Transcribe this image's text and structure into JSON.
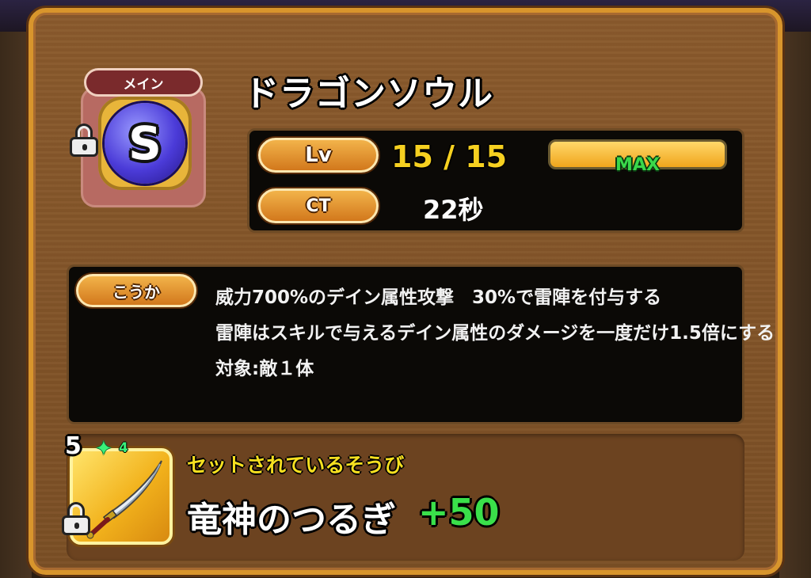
{
  "skill": {
    "tag": "メイン",
    "icon_letter": "S",
    "name": "ドラゴンソウル"
  },
  "stats": {
    "lv_label": "Lv",
    "lv_value": "15 / 15",
    "ct_label": "CT",
    "ct_value": "22秒",
    "level_bar_label": "MAX",
    "level_fraction": 1.0
  },
  "effect": {
    "label": "こうか",
    "lines": [
      "威力700%のデイン属性攻撃　30%で雷陣を付与する",
      "雷陣はスキルで与えるデイン属性のダメージを一度だけ1.5倍にする",
      "対象:敵１体"
    ]
  },
  "equipment": {
    "section_label": "セットされているそうび",
    "rank": "5",
    "gem_count": "4",
    "name": "竜神のつるぎ",
    "plus": "+50"
  },
  "colors": {
    "frame": "#d8952c",
    "panel": "#8a5a2c",
    "accent_yellow": "#f6d020",
    "green": "#3ae04a",
    "orb": "#4b3bd8"
  },
  "icons": [
    "lock-icon",
    "skill-orb-icon",
    "sword-icon",
    "gem-icon"
  ]
}
